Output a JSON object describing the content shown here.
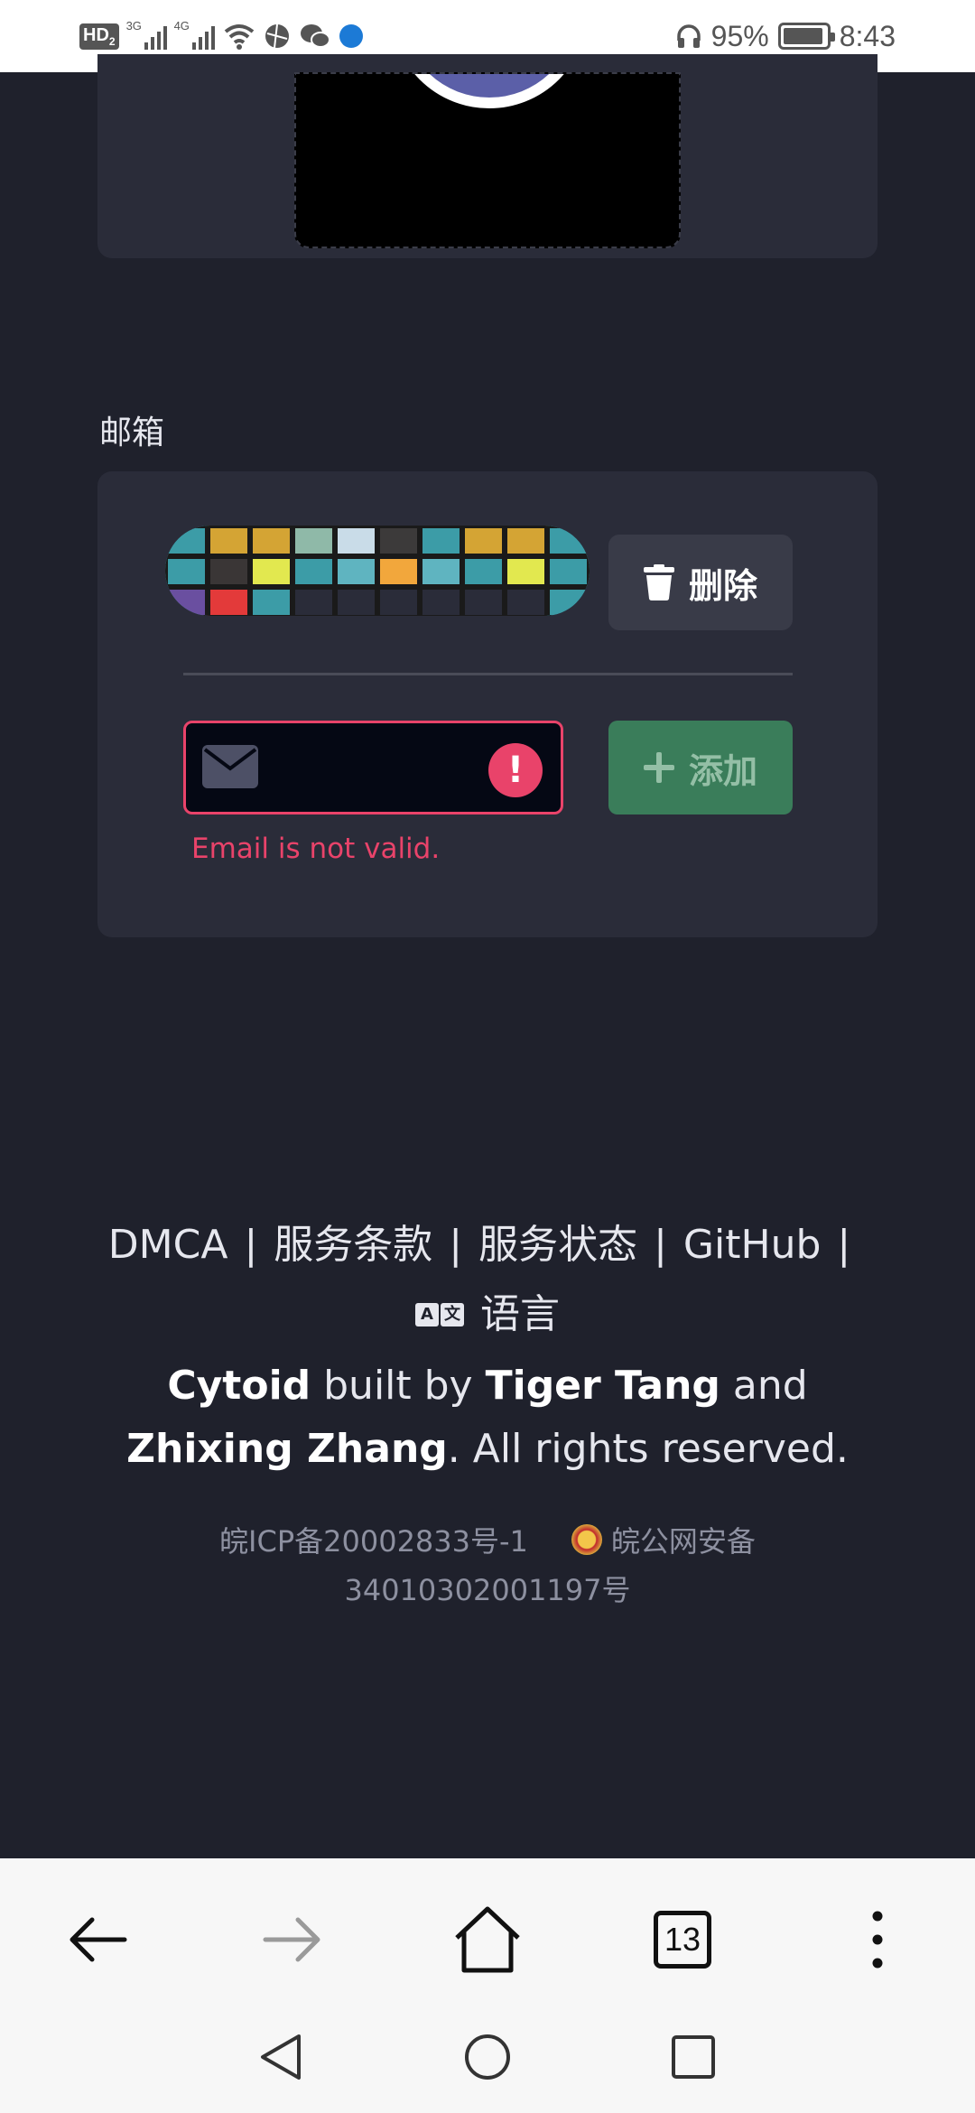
{
  "status_bar": {
    "network_badge": "HD",
    "network_badge_sub": "2",
    "signal_1_label": "3G",
    "signal_2_label": "4G",
    "battery_percent": "95%",
    "battery_level": 0.95,
    "time": "8:43"
  },
  "email_section": {
    "label": "邮箱",
    "delete_label": "删除",
    "input_value": "",
    "add_label": "添加",
    "error_message": "Email is not valid."
  },
  "footer": {
    "links": [
      "DMCA",
      "服务条款",
      "服务状态",
      "GitHub"
    ],
    "separator": "|",
    "language_icon_text": [
      "A",
      "文"
    ],
    "language_label": "语言",
    "credits": {
      "brand": "Cytoid",
      "built_by": " built by ",
      "author_1": "Tiger Tang",
      "and": " and ",
      "author_2": "Zhixing Zhang",
      "rights": ". All rights reserved."
    },
    "icp_record": "皖ICP备20002833号-1",
    "police_record": "皖公网安备 34010302001197号"
  },
  "browser": {
    "tab_count": "13"
  },
  "colors": {
    "background": "#1f212c",
    "card": "#2a2c39",
    "error": "#e9436a",
    "add_button": "#3a7d5a"
  }
}
